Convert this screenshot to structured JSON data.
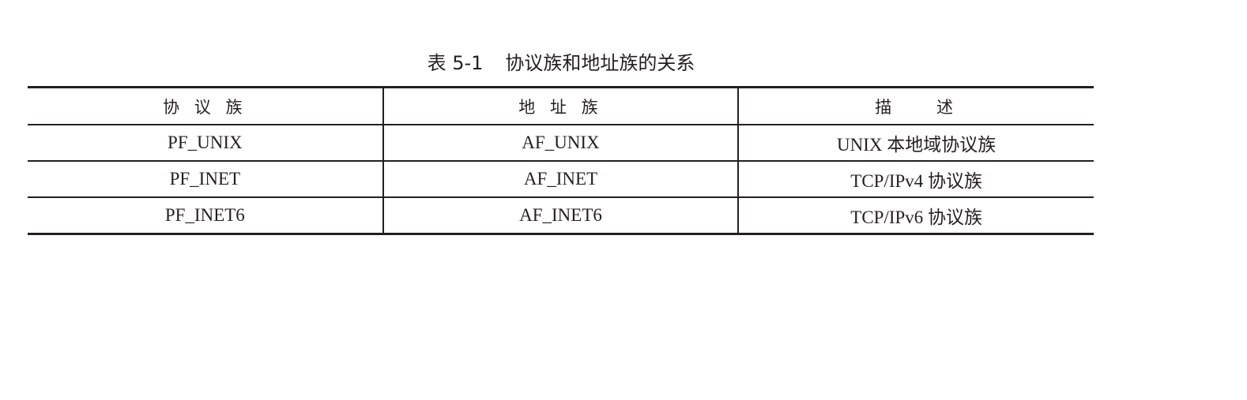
{
  "caption": {
    "number": "表 5-1",
    "text": "协议族和地址族的关系"
  },
  "table": {
    "headers": [
      "协 议 族",
      "地 址 族",
      "描    述"
    ],
    "rows": [
      [
        "PF_UNIX",
        "AF_UNIX",
        "UNIX 本地域协议族"
      ],
      [
        "PF_INET",
        "AF_INET",
        "TCP/IPv4 协议族"
      ],
      [
        "PF_INET6",
        "AF_INET6",
        "TCP/IPv6 协议族"
      ]
    ]
  }
}
